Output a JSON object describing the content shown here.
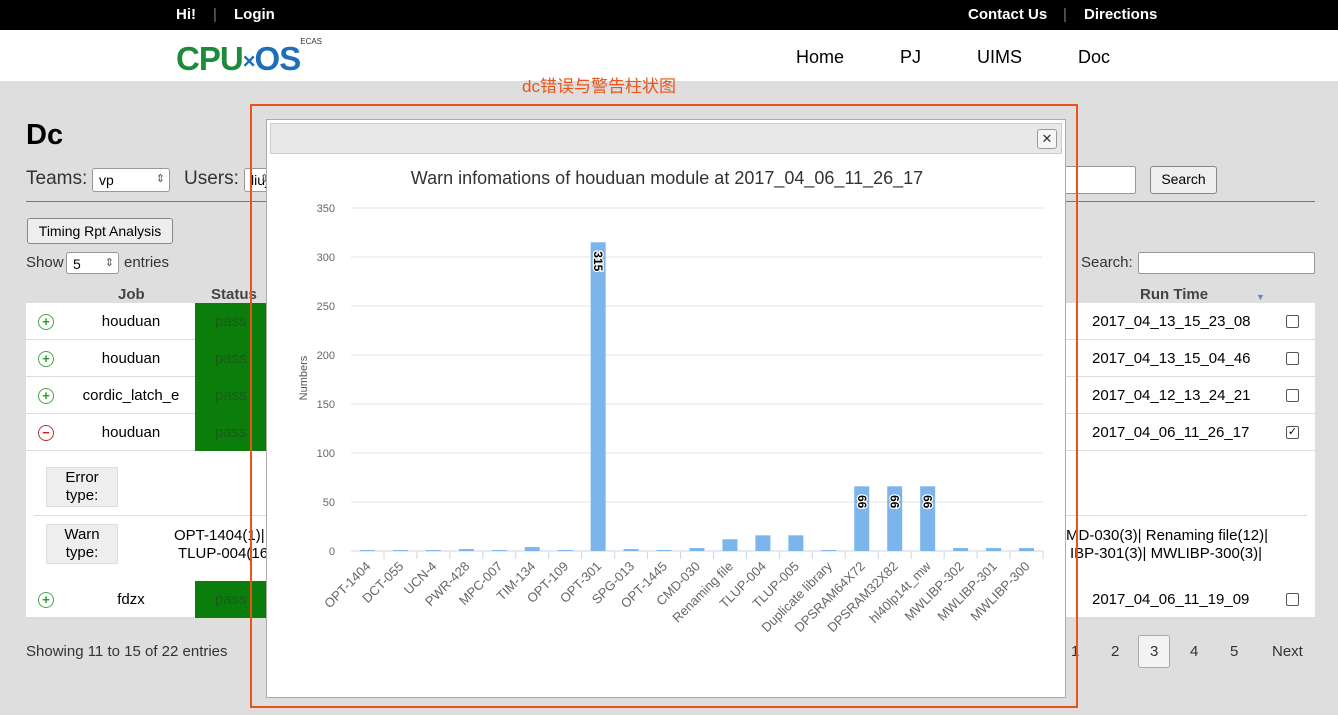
{
  "topbar": {
    "hi": "Hi!",
    "login": "Login",
    "contact": "Contact Us",
    "directions": "Directions",
    "sep": "|"
  },
  "logo": {
    "cpu": "CPU",
    "x": "×",
    "os": "OS",
    "sup": "ECAS"
  },
  "nav": {
    "home": "Home",
    "pj": "PJ",
    "uims": "UIMS",
    "doc": "Doc"
  },
  "page": {
    "title": "Dc",
    "teams_label": "Teams:",
    "teams_value": "vp",
    "users_label": "Users:",
    "users_value": "liuj",
    "search_button": "Search",
    "timing_button": "Timing Rpt Analysis",
    "show_label": "Show",
    "show_value": "5",
    "entries_label": "entries",
    "search_label": "Search:"
  },
  "table": {
    "headers": {
      "job": "Job",
      "status": "Status",
      "run_time": "Run Time"
    },
    "rows": [
      {
        "job": "houduan",
        "status": "pass",
        "run_time": "2017_04_13_15_23_08",
        "checked": ""
      },
      {
        "job": "houduan",
        "status": "pass",
        "run_time": "2017_04_13_15_04_46",
        "checked": ""
      },
      {
        "job": "cordic_latch_e",
        "status": "pass",
        "run_time": "2017_04_12_13_24_21",
        "checked": ""
      },
      {
        "job": "houduan",
        "status": "pass",
        "run_time": "2017_04_06_11_26_17",
        "checked": "✓"
      },
      {
        "job": "fdzx",
        "status": "pass",
        "run_time": "2017_04_06_11_19_09",
        "checked": ""
      }
    ],
    "detail": {
      "error_label_1": "Error",
      "error_label_2": "type:",
      "warn_label_1": "Warn",
      "warn_label_2": "type:",
      "warn_left_1": "OPT-1404(1)|",
      "warn_left_2": "TLUP-004(16",
      "warn_right_1": "MD-030(3)| Renaming file(12)|",
      "warn_right_2": "IBP-301(3)| MWLIBP-300(3)|"
    }
  },
  "footer": {
    "showing": "Showing 11 to 15 of 22 entries",
    "pages": [
      "1",
      "2",
      "3",
      "4",
      "5"
    ],
    "next": "Next"
  },
  "annotation": "dc错误与警告柱状图",
  "dialog": {
    "close": "✕"
  },
  "colors": {
    "bar": "#7cb5ec",
    "status_green": "#0a7d0a",
    "annotation": "#e8541c"
  },
  "chart_data": {
    "type": "bar",
    "title": "Warn infomations of houduan module at 2017_04_06_11_26_17",
    "ylabel": "Numbers",
    "xlabel": "",
    "ylim": [
      0,
      350
    ],
    "yticks": [
      0,
      50,
      100,
      150,
      200,
      250,
      300,
      350
    ],
    "grid": true,
    "categories": [
      "OPT-1404",
      "DCT-055",
      "UCN-4",
      "PWR-428",
      "MPC-007",
      "TIM-134",
      "OPT-109",
      "OPT-301",
      "SPG-013",
      "OPT-1445",
      "CMD-030",
      "Renaming file",
      "TLUP-004",
      "TLUP-005",
      "Duplicate library",
      "DPSRAM64X72",
      "DPSRAM32X82",
      "hl40lp14t_mw",
      "MWLIBP-302",
      "MWLIBP-301",
      "MWLIBP-300"
    ],
    "values": [
      1,
      1,
      1,
      2,
      1,
      4,
      1,
      315,
      2,
      1,
      3,
      12,
      16,
      16,
      1,
      66,
      66,
      66,
      3,
      3,
      3
    ],
    "data_labels": [
      "",
      "",
      "",
      "",
      "",
      "",
      "",
      "315",
      "",
      "",
      "",
      "",
      "",
      "",
      "",
      "66",
      "66",
      "66",
      "",
      "",
      ""
    ]
  }
}
